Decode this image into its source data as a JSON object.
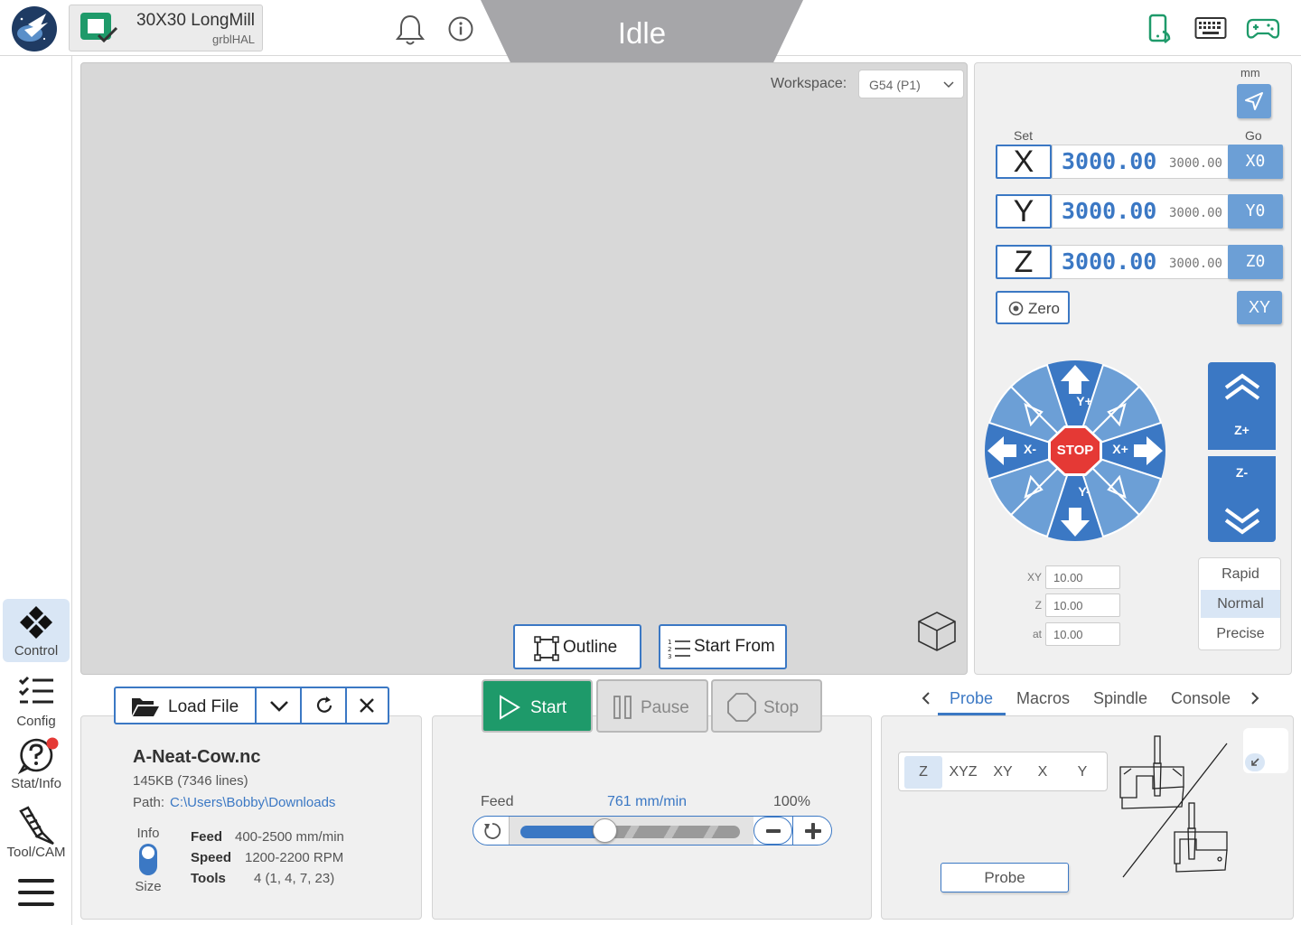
{
  "header": {
    "machine_name": "30X30 LongMill",
    "firmware": "grblHAL",
    "state": "Idle"
  },
  "sidebar": {
    "items": [
      {
        "label": "Control",
        "icon": "control-diamond-icon",
        "active": true
      },
      {
        "label": "Config",
        "icon": "checklist-icon",
        "active": false
      },
      {
        "label": "Stat/Info",
        "icon": "help-circle-icon",
        "active": false
      },
      {
        "label": "Tool/CAM",
        "icon": "endmill-icon",
        "active": false
      }
    ]
  },
  "visualizer": {
    "workspace_label": "Workspace:",
    "workspace_value": "G54 (P1)",
    "outline_label": "Outline",
    "start_from_label": "Start From"
  },
  "dro": {
    "units": "mm",
    "set_label": "Set",
    "go_label": "Go",
    "axes": [
      {
        "axis": "X",
        "work": "3000.00",
        "machine": "3000.00",
        "go": "X0"
      },
      {
        "axis": "Y",
        "work": "3000.00",
        "machine": "3000.00",
        "go": "Y0"
      },
      {
        "axis": "Z",
        "work": "3000.00",
        "machine": "3000.00",
        "go": "Z0"
      }
    ],
    "zero_label": "Zero",
    "xy_label": "XY"
  },
  "jog": {
    "y_plus": "Y+",
    "y_minus": "Y-",
    "x_plus": "X+",
    "x_minus": "X-",
    "stop": "STOP",
    "z_plus": "Z+",
    "z_minus": "Z-",
    "xy_label": "XY",
    "xy_value": "10.00",
    "z_label": "Z",
    "z_value": "10.00",
    "at_label": "at",
    "at_value": "10.00",
    "speeds": [
      "Rapid",
      "Normal",
      "Precise"
    ],
    "selected_speed": "Normal"
  },
  "file": {
    "load_label": "Load File",
    "name": "A-Neat-Cow.nc",
    "size": "145KB (7346 lines)",
    "path_label": "Path:",
    "path": "C:\\Users\\Bobby\\Downloads",
    "toggle_top": "Info",
    "toggle_bottom": "Size",
    "feed_label": "Feed",
    "feed_value": "400-2500 mm/min",
    "speed_label": "Speed",
    "speed_value": "1200-2200 RPM",
    "tools_label": "Tools",
    "tools_value": "4 (1, 4, 7, 23)"
  },
  "run": {
    "start_label": "Start",
    "pause_label": "Pause",
    "stop_label": "Stop",
    "feed_label": "Feed",
    "feed_rate": "761 mm/min",
    "feed_percent": "100%",
    "feed_slider_fraction": 0.38
  },
  "tools": {
    "tabs": [
      "Probe",
      "Macros",
      "Spindle",
      "Console"
    ],
    "active_tab": "Probe",
    "probe_axes": [
      "Z",
      "XYZ",
      "XY",
      "X",
      "Y"
    ],
    "selected_axis": "Z",
    "probe_button": "Probe"
  },
  "colors": {
    "accent": "#3b78c4",
    "button_blue": "#6c9fd6",
    "start_green": "#1e9a6a",
    "stop_red": "#e53935",
    "header_green": "#1e9a6a",
    "state_grey": "#a6a6a9"
  }
}
